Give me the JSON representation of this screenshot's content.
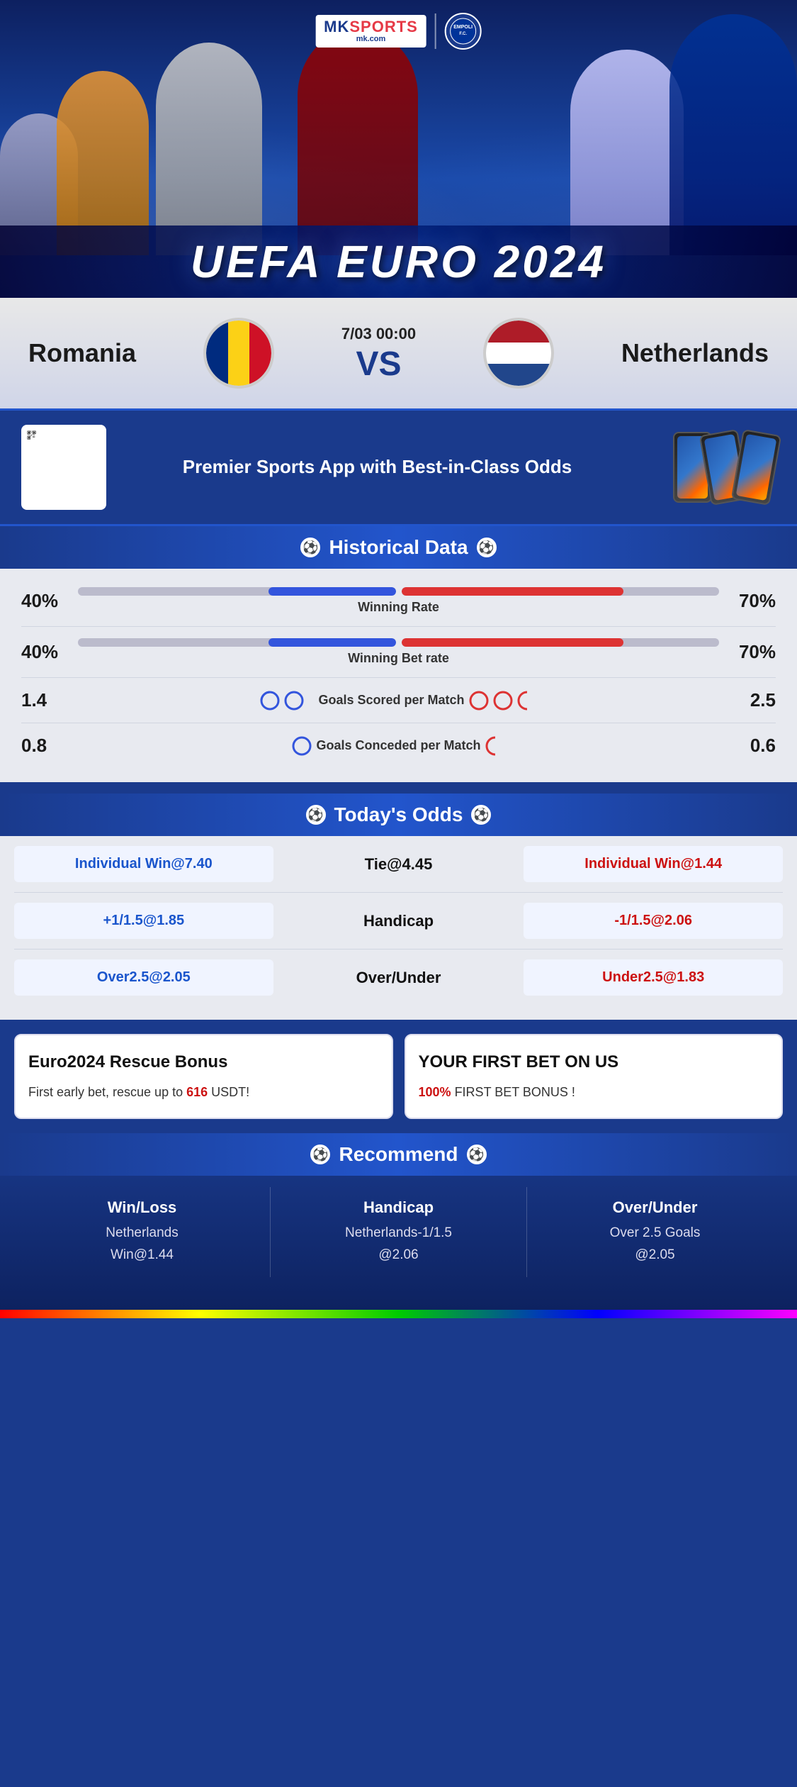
{
  "brand": {
    "name": "MK SPORTS",
    "url": "mk.com",
    "tagline": "Premier Sports App with Best-in-Class Odds"
  },
  "event": {
    "title": "UEFA EURO 2024",
    "date": "7/03 00:00",
    "vs": "VS",
    "team_home": "Romania",
    "team_away": "Netherlands"
  },
  "historical": {
    "section_title": "Historical Data",
    "winning_rate_label": "Winning Rate",
    "winning_rate_home": "40%",
    "winning_rate_away": "70%",
    "winning_rate_home_pct": 40,
    "winning_rate_away_pct": 70,
    "winning_bet_label": "Winning Bet rate",
    "winning_bet_home": "40%",
    "winning_bet_away": "70%",
    "winning_bet_home_pct": 40,
    "winning_bet_away_pct": 70,
    "goals_scored_label": "Goals Scored per Match",
    "goals_scored_home": "1.4",
    "goals_scored_away": "2.5",
    "goals_conceded_label": "Goals Conceded per Match",
    "goals_conceded_home": "0.8",
    "goals_conceded_away": "0.6"
  },
  "odds": {
    "section_title": "Today's Odds",
    "individual_win_home": "Individual Win@7.40",
    "tie": "Tie@4.45",
    "individual_win_away": "Individual Win@1.44",
    "handicap_label": "Handicap",
    "handicap_home": "+1/1.5@1.85",
    "handicap_away": "-1/1.5@2.06",
    "over_under_label": "Over/Under",
    "over_home": "Over2.5@2.05",
    "under_away": "Under2.5@1.83"
  },
  "bonus": {
    "card1_title": "Euro2024 Rescue Bonus",
    "card1_text": "First early bet, rescue up to",
    "card1_highlight": "616",
    "card1_suffix": " USDT!",
    "card2_title": "YOUR FIRST BET ON US",
    "card2_highlight": "100%",
    "card2_text": " FIRST BET BONUS !"
  },
  "recommend": {
    "section_title": "Recommend",
    "col1_label": "Win/Loss",
    "col1_line1": "Netherlands",
    "col1_line2": "Win@1.44",
    "col2_label": "Handicap",
    "col2_line1": "Netherlands-1/1.5",
    "col2_line2": "@2.06",
    "col3_label": "Over/Under",
    "col3_line1": "Over 2.5 Goals",
    "col3_line2": "@2.05"
  }
}
